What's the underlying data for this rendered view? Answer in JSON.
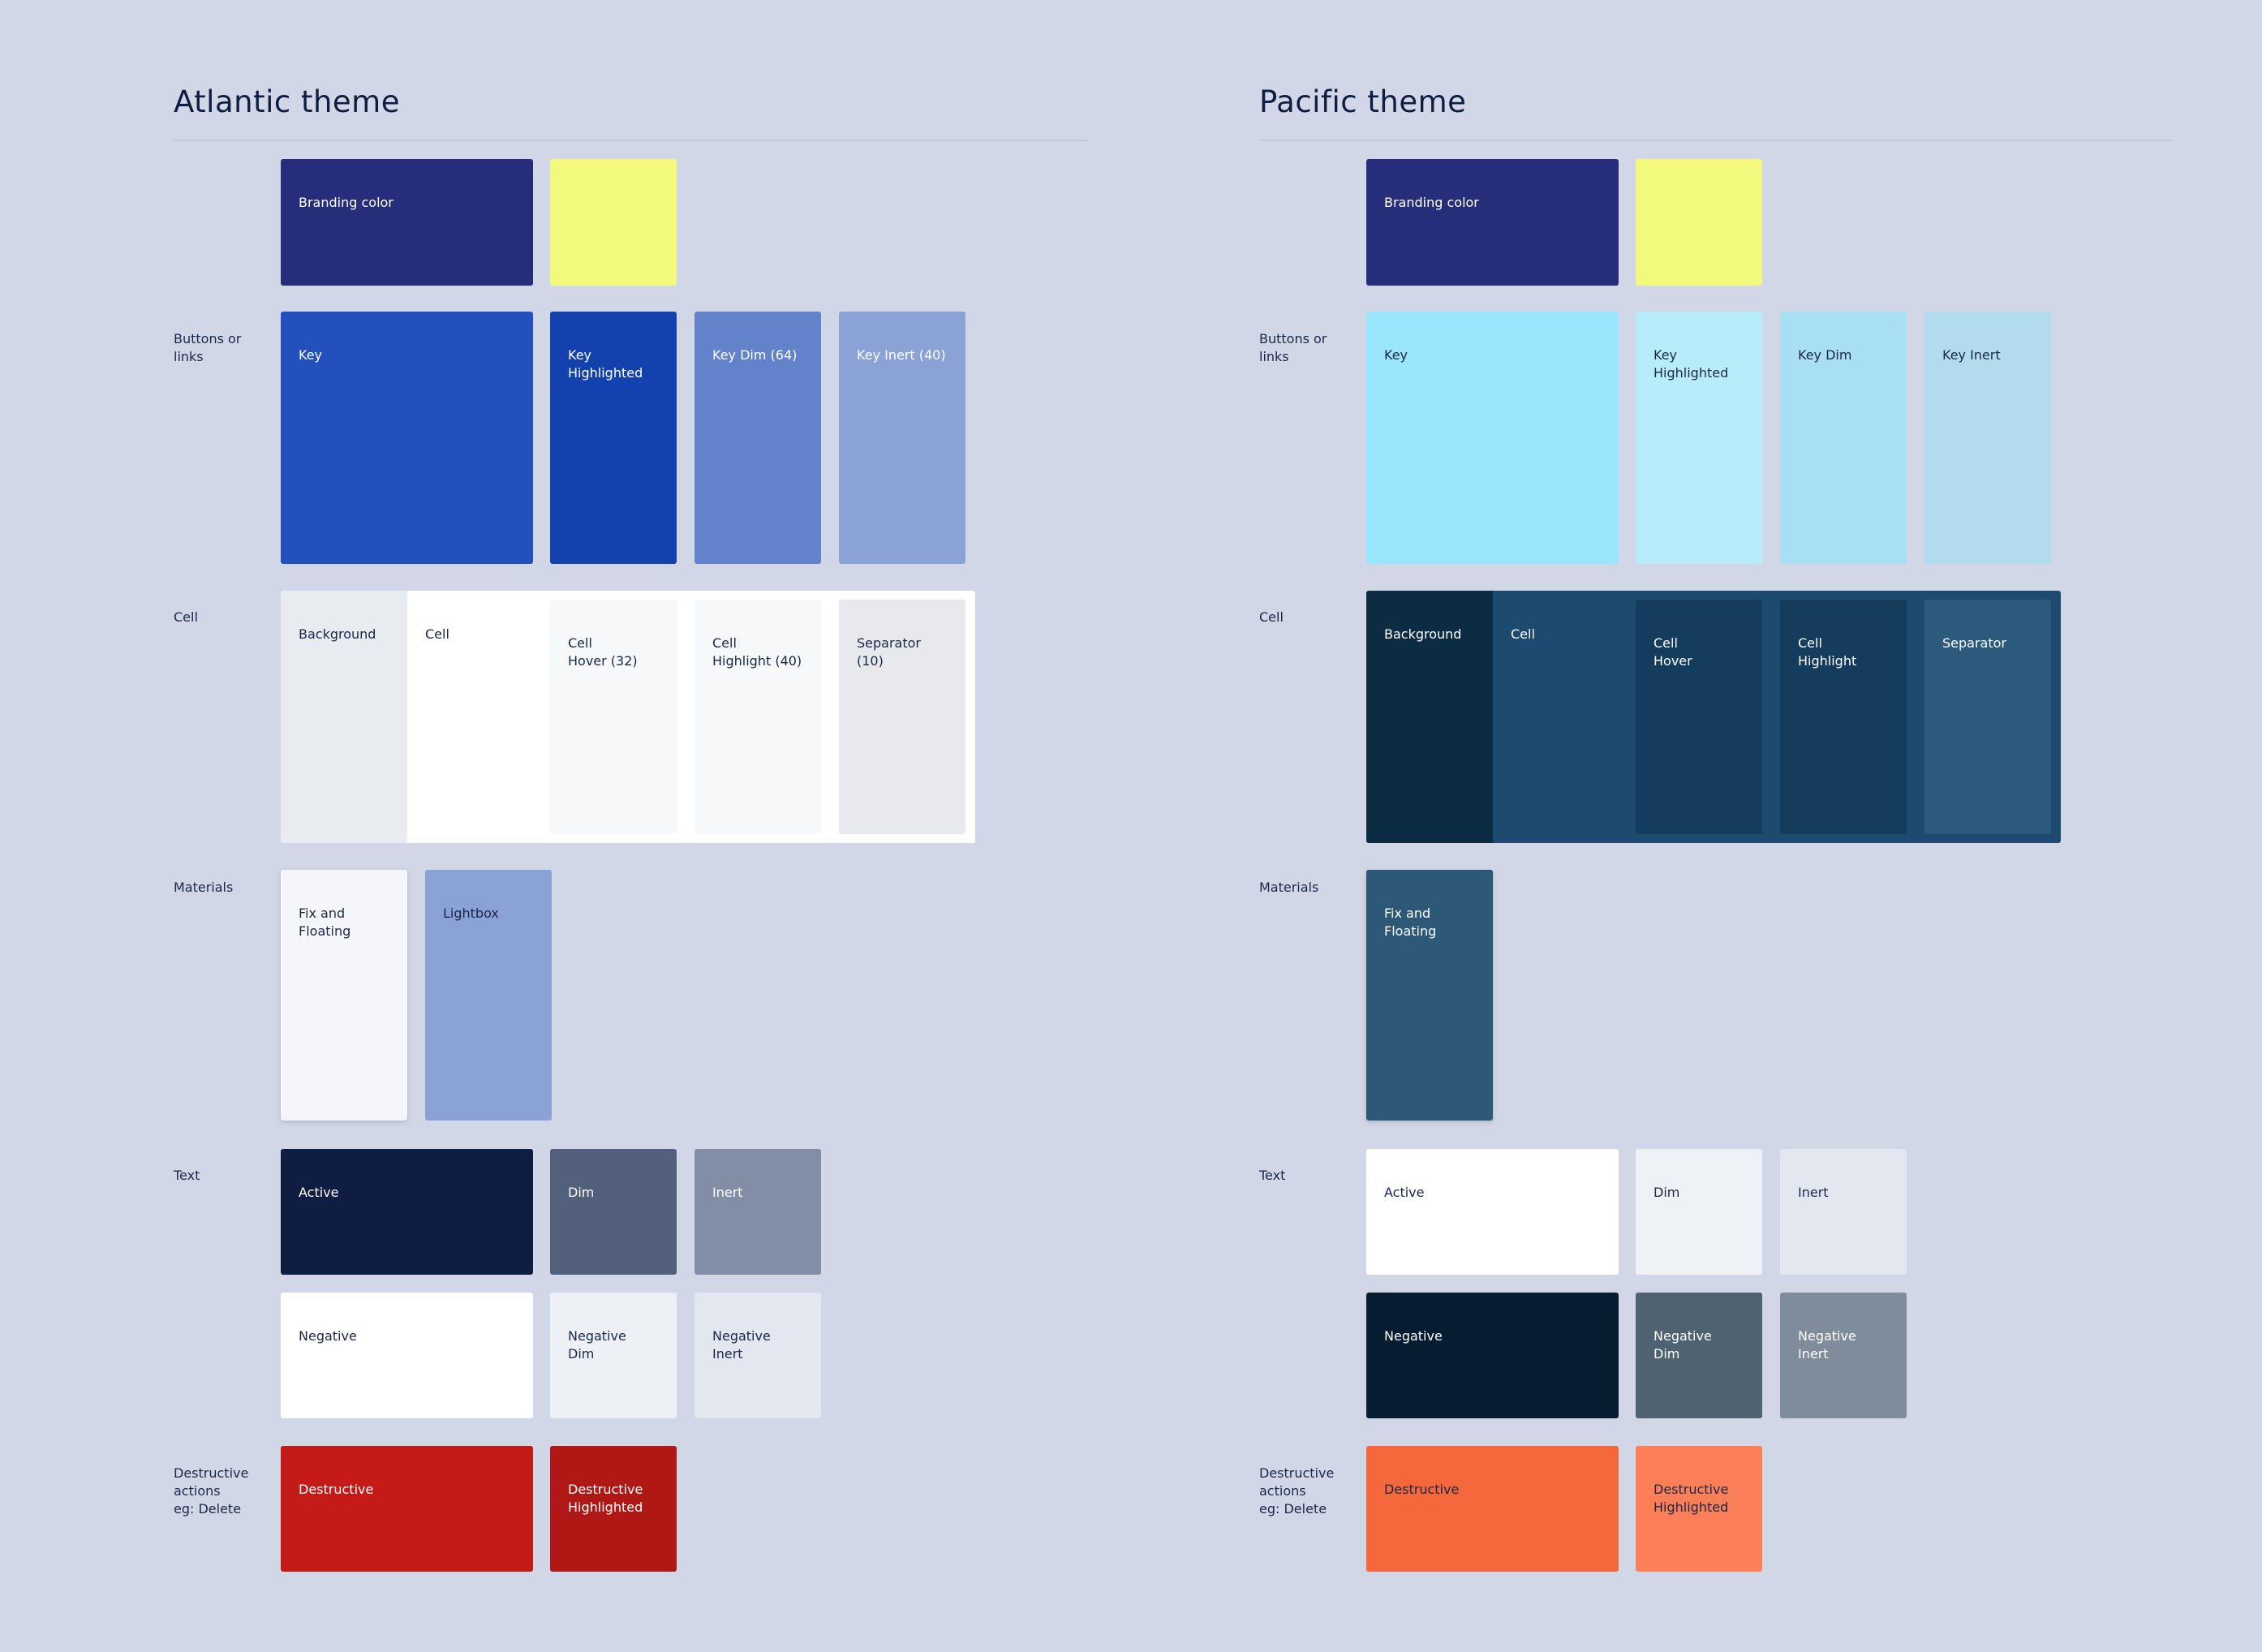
{
  "atlantic": {
    "title": "Atlantic theme",
    "rows": {
      "buttons": "Buttons or\nlinks",
      "cell": "Cell",
      "materials": "Materials",
      "text": "Text",
      "destructive": "Destructive\nactions\neg: Delete"
    },
    "branding": {
      "label": "Branding color",
      "color": "#262d7a",
      "accent": "#f3f97d"
    },
    "buttons": [
      {
        "label": "Key",
        "color": "#2251be"
      },
      {
        "label": "Key\nHighlighted",
        "color": "#1342ae"
      },
      {
        "label": "Key Dim (64)",
        "color": "#6282cc"
      },
      {
        "label": "Key Inert (40)",
        "color": "#8aa2d5"
      }
    ],
    "cell": {
      "strip_color": "#ffffff",
      "items": [
        {
          "label": "Background",
          "color": "#e8ecf1"
        },
        {
          "label": "Cell",
          "color": "#ffffff"
        },
        {
          "label": "Cell\nHover (32)",
          "color": "#f6f8fa"
        },
        {
          "label": "Cell\nHighlight (40)",
          "color": "#f6f8fa"
        },
        {
          "label": "Separator (10)",
          "color": "#e7e9ed"
        }
      ]
    },
    "materials": [
      {
        "label": "Fix and\nFloating",
        "color": "#f5f6f9"
      },
      {
        "label": "Lightbox",
        "color": "#8aa2d5"
      }
    ],
    "text": [
      {
        "label": "Active",
        "color": "#101d42"
      },
      {
        "label": "Dim",
        "color": "#53607d"
      },
      {
        "label": "Inert",
        "color": "#828ea6"
      },
      {
        "label": "Negative",
        "color": "#ffffff"
      },
      {
        "label": "Negative\nDim",
        "color": "#edf0f5"
      },
      {
        "label": "Negative\nInert",
        "color": "#e3e7f0"
      }
    ],
    "destructive": [
      {
        "label": "Destructive",
        "color": "#c41a18"
      },
      {
        "label": "Destructive\nHighlighted",
        "color": "#b01816"
      }
    ]
  },
  "pacific": {
    "title": "Pacific theme",
    "rows": {
      "buttons": "Buttons or\nlinks",
      "cell": "Cell",
      "materials": "Materials",
      "text": "Text",
      "destructive": "Destructive\nactions\neg: Delete"
    },
    "branding": {
      "label": "Branding color",
      "color": "#262d7a",
      "accent": "#f3f97d"
    },
    "buttons": [
      {
        "label": "Key",
        "color": "#9ae6fc"
      },
      {
        "label": "Key\nHighlighted",
        "color": "#b7ecfb"
      },
      {
        "label": "Key Dim",
        "color": "#a8dff2"
      },
      {
        "label": "Key Inert",
        "color": "#b0dcee"
      }
    ],
    "cell": {
      "strip_color": "#1c4b6f",
      "items": [
        {
          "label": "Background",
          "color": "#0c2c44"
        },
        {
          "label": "Cell",
          "color": "#1c4b6f"
        },
        {
          "label": "Cell\nHover",
          "color": "#143c5d"
        },
        {
          "label": "Cell\nHighlight",
          "color": "#143c5d"
        },
        {
          "label": "Separator",
          "color": "#2c5a7c"
        }
      ]
    },
    "materials": [
      {
        "label": "Fix and\nFloating",
        "color": "#2d5878"
      }
    ],
    "text": [
      {
        "label": "Active",
        "color": "#ffffff"
      },
      {
        "label": "Dim",
        "color": "#eef1f5"
      },
      {
        "label": "Inert",
        "color": "#e3e7f0"
      },
      {
        "label": "Negative",
        "color": "#061c30"
      },
      {
        "label": "Negative\nDim",
        "color": "#4e6272"
      },
      {
        "label": "Negative\nInert",
        "color": "#7f8c9b"
      }
    ],
    "destructive": [
      {
        "label": "Destructive",
        "color": "#f5683c"
      },
      {
        "label": "Destructive\nHighlighted",
        "color": "#fd7f57"
      }
    ]
  }
}
